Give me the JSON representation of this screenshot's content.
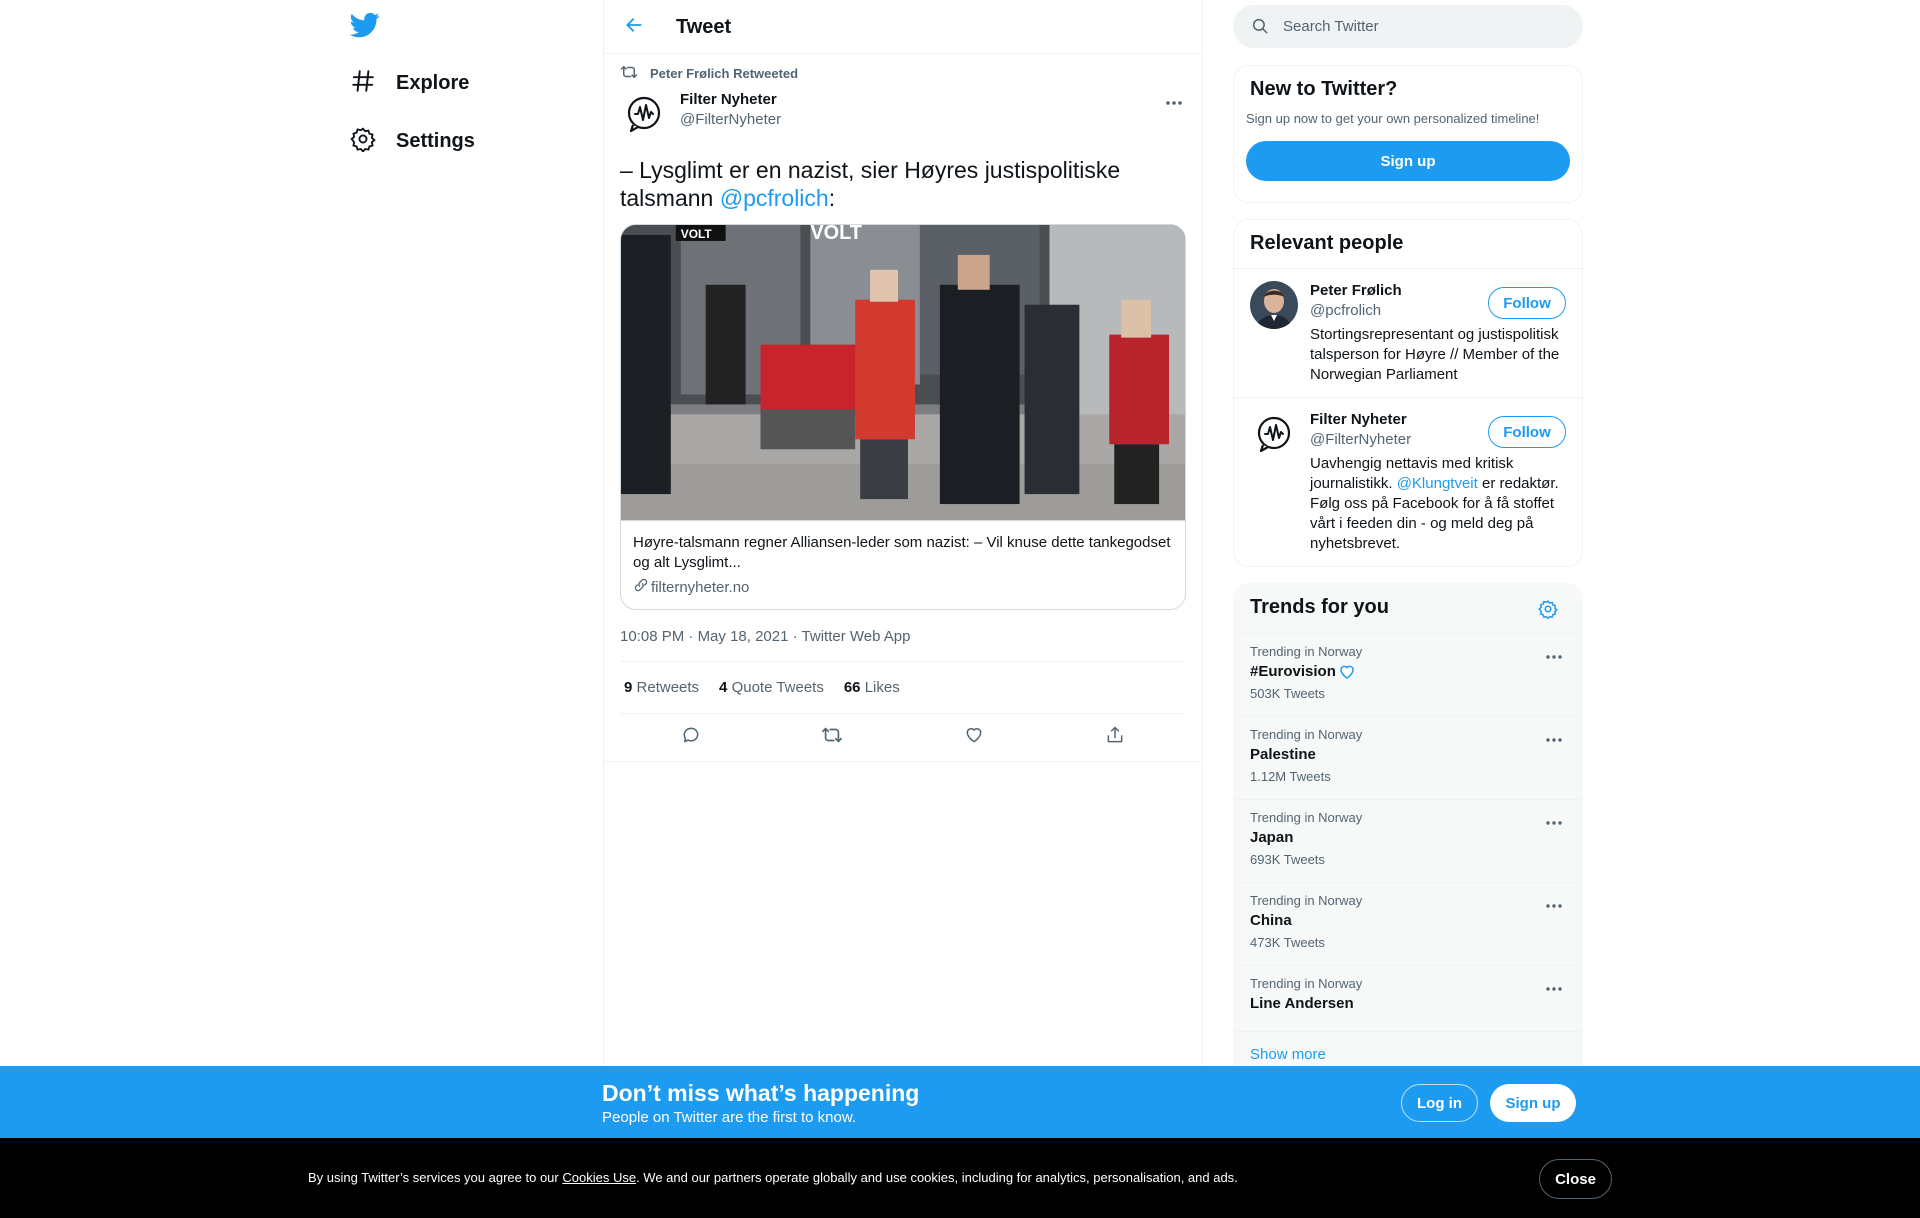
{
  "nav": {
    "explore_label": "Explore",
    "settings_label": "Settings"
  },
  "header": {
    "title": "Tweet"
  },
  "tweet": {
    "retweeted_by": "Peter Frølich Retweeted",
    "author_name": "Filter Nyheter",
    "author_handle": "@FilterNyheter",
    "text_before": "– Lysglimt er en nazist, sier Høyres justispolitiske talsmann ",
    "mention": "@pcfrolich",
    "text_after": ":",
    "card": {
      "image_labels": [
        "VOLT",
        "VOLT"
      ],
      "title": "Høyre-talsmann regner Alliansen-leder som nazist: – Vil knuse dette tankegodset og alt Lysglimt...",
      "domain": "filternyheter.no"
    },
    "time": "10:08 PM",
    "date": "May 18, 2021",
    "source": "Twitter Web App",
    "separator": " · ",
    "retweets_count": "9",
    "retweets_label": "Retweets",
    "quotes_count": "4",
    "quotes_label": "Quote Tweets",
    "likes_count": "66",
    "likes_label": "Likes"
  },
  "search": {
    "placeholder": "Search Twitter"
  },
  "new_to_twitter": {
    "title": "New to Twitter?",
    "subtitle": "Sign up now to get your own personalized timeline!",
    "signup_label": "Sign up"
  },
  "relevant_people": {
    "title": "Relevant people",
    "people": [
      {
        "name": "Peter Frølich",
        "handle": "@pcfrolich",
        "bio": "Stortingsrepresentant og justispolitisk talsperson for Høyre // Member of the Norwegian Parliament",
        "follow_label": "Follow"
      },
      {
        "name": "Filter Nyheter",
        "handle": "@FilterNyheter",
        "bio_before": "Uavhengig nettavis med kritisk journalistikk. ",
        "bio_mention": "@Klungtveit",
        "bio_after": " er redaktør. Følg oss på Facebook for å få stoffet vårt i feeden din - og meld deg på nyhetsbrevet.",
        "follow_label": "Follow"
      }
    ]
  },
  "trends": {
    "title": "Trends for you",
    "items": [
      {
        "context": "Trending in Norway",
        "name": "#Eurovision",
        "count": "503K Tweets"
      },
      {
        "context": "Trending in Norway",
        "name": "Palestine",
        "count": "1.12M Tweets"
      },
      {
        "context": "Trending in Norway",
        "name": "Japan",
        "count": "693K Tweets"
      },
      {
        "context": "Trending in Norway",
        "name": "China",
        "count": "473K Tweets"
      },
      {
        "context": "Trending in Norway",
        "name": "Line Andersen",
        "count": ""
      }
    ],
    "show_more_label": "Show more"
  },
  "banner": {
    "title": "Don’t miss what’s happening",
    "subtitle": "People on Twitter are the first to know.",
    "login_label": "Log in",
    "signup_label": "Sign up"
  },
  "cookie": {
    "text_before": "By using Twitter’s services you agree to our ",
    "link_label": "Cookies Use",
    "text_after": ". We and our partners operate globally and use cookies, including for analytics, personalisation, and ads.",
    "close_label": "Close"
  },
  "colors": {
    "accent": "#1d9bf0",
    "text_primary": "#0f1419",
    "text_secondary": "#536471",
    "cookie_bg": "#000000"
  }
}
